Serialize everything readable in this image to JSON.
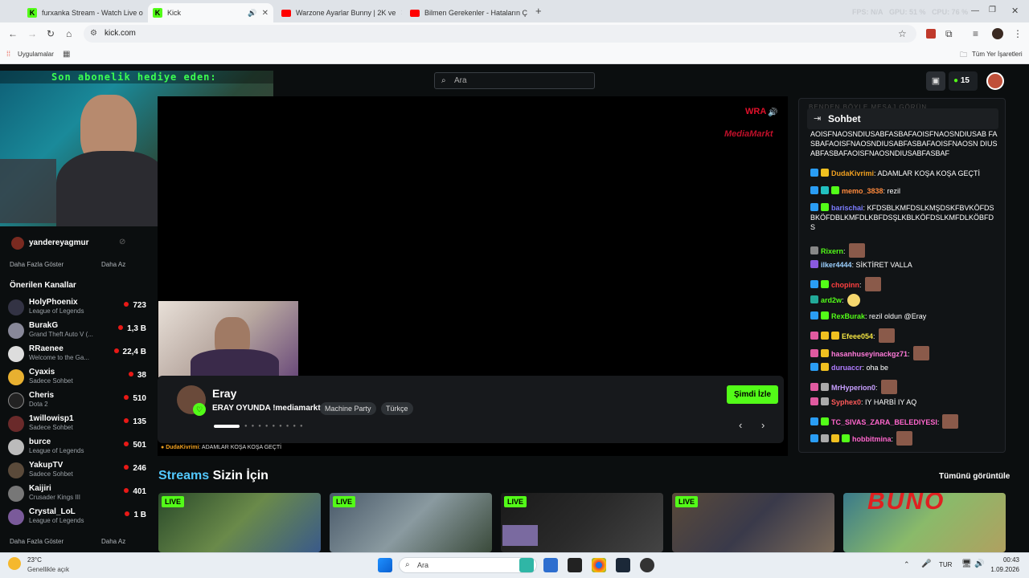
{
  "browser": {
    "tabs": [
      {
        "title": "furxanka Stream - Watch Live o"
      },
      {
        "title": "Kick"
      },
      {
        "title": "Warzone Ayarlar Bunny | 2K ve"
      },
      {
        "title": "Bilmen Gerekenler - Hataların Ç"
      }
    ],
    "url": "kick.com",
    "bookmarks_apps": "Uygulamalar",
    "bookmarks_all": "Tüm Yer İşaretleri",
    "overlay_stats": {
      "fps": "FPS: N/A",
      "gpu": "GPU: 51 %",
      "cpu": "CPU: 76 %"
    }
  },
  "header": {
    "search_placeholder": "Ara",
    "points": "15"
  },
  "webcam_overlay": "Son abonelik hediye eden:",
  "sidebar": {
    "followed": {
      "name": "yandereyagmur"
    },
    "show_more": "Daha Fazla Göster",
    "show_less": "Daha Az",
    "recommended_title": "Önerilen Kanallar",
    "channels": [
      {
        "name": "HolyPhoenix",
        "game": "League of Legends",
        "viewers": "723"
      },
      {
        "name": "BurakG",
        "game": "Grand Theft Auto V (...",
        "viewers": "1,3 B"
      },
      {
        "name": "RRaenee",
        "game": "Welcome to the Ga...",
        "viewers": "22,4 B"
      },
      {
        "name": "Cyaxis",
        "game": "Sadece Sohbet",
        "viewers": "38"
      },
      {
        "name": "Cheris",
        "game": "Dota 2",
        "viewers": "510"
      },
      {
        "name": "1willowisp1",
        "game": "Sadece Sohbet",
        "viewers": "135"
      },
      {
        "name": "burce",
        "game": "League of Legends",
        "viewers": "501"
      },
      {
        "name": "YakupTV",
        "game": "Sadece Sohbet",
        "viewers": "246"
      },
      {
        "name": "Kaijiri",
        "game": "Crusader Kings III",
        "viewers": "401"
      },
      {
        "name": "Crystal_LoL",
        "game": "League of Legends",
        "viewers": "1 B"
      }
    ],
    "show_more2": "Daha Fazla Göster",
    "show_less2": "Daha Az"
  },
  "player": {
    "logo_text": "MediaMarkt",
    "logo_text2": "WRA"
  },
  "featured": {
    "streamer": "Eray",
    "title": "ERAY OYUNDA !mediamarkt",
    "tags": [
      "Machine Party",
      "Türkçe"
    ],
    "watch_button": "Şimdi İzle",
    "chat_preview_user": "DudaKivrimi",
    "chat_preview_text": ": ADAMLAR KOŞA KOŞA GEÇTİ"
  },
  "chat": {
    "title": "Sohbet",
    "pinned_ghost": "BENDEN BÖYLE MESAJ GÖRÜN",
    "top_text": "AOISFNAOSNDIUSABFASBAFAOISFNAOSNDIUSAB FASBAFAOISFNAOSNDIUSABFASBAFAOISFNAOSN DIUSABFASBAFAOISFNAOSNDIUSABFASBAF",
    "messages": [
      {
        "user": "DudaKivrimi",
        "color": "#f0a020",
        "text": ": ADAMLAR KOŞA KOŞA GEÇTİ"
      },
      {
        "user": "memo_3838",
        "color": "#ff8a3d",
        "text": ": rezil"
      },
      {
        "user": "barischai",
        "color": "#7c7cff",
        "text": ": KFDSBLKMFDSLKMŞDSKFBVKÖFDSBKÖFDBLKMFDLKBFDSŞLKBLKÖFDSLKMFDLKÖBFDS"
      },
      {
        "user": "Rixern",
        "color": "#53fc18",
        "text": ":"
      },
      {
        "user": "ilker4444",
        "color": "#9bd0ff",
        "text": ": SİKTİRET VALLA"
      },
      {
        "user": "chopinn",
        "color": "#ff4040",
        "text": ":"
      },
      {
        "user": "ard2w",
        "color": "#53fc18",
        "text": ":"
      },
      {
        "user": "RexBurak",
        "color": "#53fc18",
        "text": ": rezil oldun @Eray"
      },
      {
        "user": "Efeee054",
        "color": "#f5e642",
        "text": ":"
      },
      {
        "user": "hasanhuseyinackgz71",
        "color": "#ff7ad9",
        "text": ":"
      },
      {
        "user": "duruaccr",
        "color": "#b07cff",
        "text": ": oha be"
      },
      {
        "user": "MrHyperion0",
        "color": "#c8a0ff",
        "text": ":"
      },
      {
        "user": "Syphex0",
        "color": "#ff5a5a",
        "text": ": IY HARBİ IY AQ"
      },
      {
        "user": "TC_SIVAS_ZARA_BELEDIYESI",
        "color": "#ff66cc",
        "text": ":"
      },
      {
        "user": "hobbitmina",
        "color": "#ff66cc",
        "text": ":"
      }
    ]
  },
  "streams_section": {
    "title_a": "Streams",
    "title_b": "Sizin İçin",
    "view_all": "Tümünü görüntüle",
    "live_badge": "LIVE",
    "thumb_overlay": "BUNO"
  },
  "taskbar": {
    "weather_temp": "23°C",
    "weather_desc": "Genellikle açık",
    "search": "Ara",
    "lang": "TUR",
    "time": "00:43",
    "date": "1.09.2026"
  }
}
